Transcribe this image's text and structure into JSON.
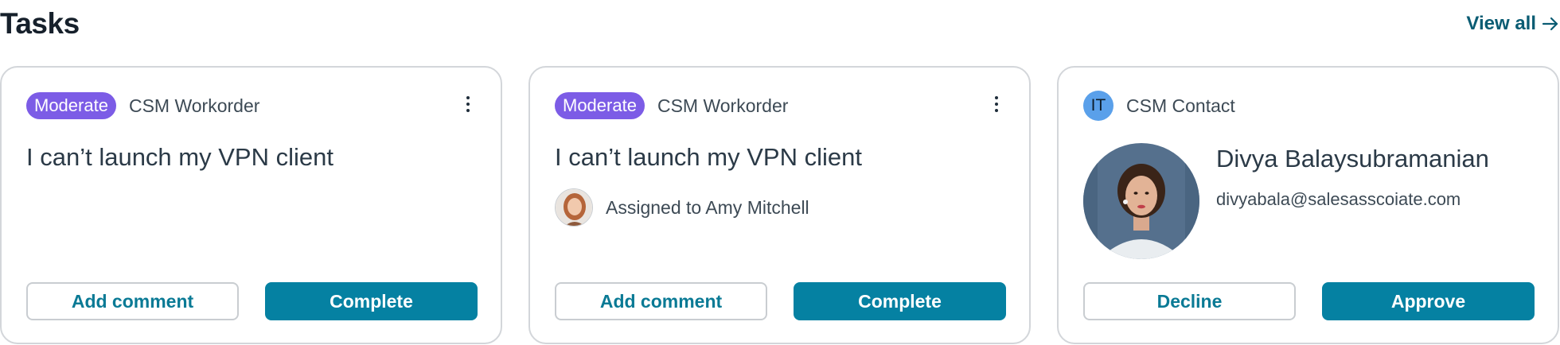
{
  "header": {
    "title": "Tasks",
    "view_all_label": "View all",
    "view_all_icon": "arrow-right-icon"
  },
  "colors": {
    "accent": "#0581a2",
    "link": "#0a5c73",
    "badge_moderate": "#7c5ce6",
    "it_badge": "#5aa0ea"
  },
  "cards": [
    {
      "badge": "Moderate",
      "type_label": "CSM Workorder",
      "title": "I can’t launch my VPN client",
      "menu_icon": "more-vertical-icon",
      "secondary_button": "Add comment",
      "primary_button": "Complete"
    },
    {
      "badge": "Moderate",
      "type_label": "CSM Workorder",
      "title": "I can’t launch my VPN client",
      "assignee_text": "Assigned to Amy Mitchell",
      "menu_icon": "more-vertical-icon",
      "secondary_button": "Add comment",
      "primary_button": "Complete"
    },
    {
      "badge": "IT",
      "type_label": "CSM Contact",
      "contact_name": "Divya Balaysubramanian",
      "contact_email": "divyabala@salesasscoiate.com",
      "secondary_button": "Decline",
      "primary_button": "Approve"
    }
  ]
}
